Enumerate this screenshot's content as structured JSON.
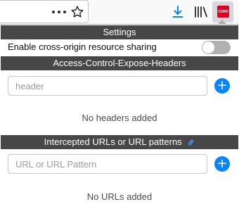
{
  "toolbar": {
    "overflow_icon": "page-actions-dots-icon",
    "bookmark_icon": "star-icon",
    "download_icon": "download-arrow-icon",
    "library_icon": "library-icon",
    "extension_badge_label": "CORS",
    "download_color": "#0a84ff",
    "badge_color": "#d70022"
  },
  "panel": {
    "settings_header": "Settings",
    "cors_toggle_label": "Enable cross-origin resource sharing",
    "cors_enabled": false,
    "expose_headers": {
      "header": "Access-Control-Expose-Headers",
      "input_placeholder": "header",
      "input_value": "",
      "add_label": "+",
      "empty_message": "No headers added"
    },
    "intercepted_urls": {
      "header": "Intercepted URLs or URL patterns",
      "header_icon": "link-icon",
      "input_placeholder": "URL or URL Pattern",
      "input_value": "",
      "add_label": "+",
      "empty_message": "No URLs added"
    },
    "header_bg": "#474747",
    "accent": "#0a84ff"
  }
}
